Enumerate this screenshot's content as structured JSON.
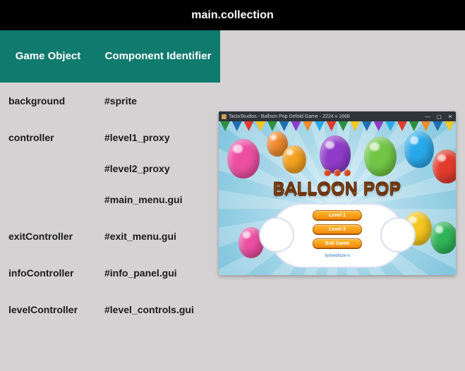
{
  "title": "main.collection",
  "table": {
    "headers": {
      "game_object": "Game Object",
      "component_identifier": "Component Identifier"
    },
    "rows": [
      {
        "go": "background",
        "ci": [
          "#sprite"
        ]
      },
      {
        "go": "controller",
        "ci": [
          "#level1_proxy",
          "#level2_proxy",
          "#main_menu.gui"
        ]
      },
      {
        "go": "exitController",
        "ci": [
          "#exit_menu.gui"
        ]
      },
      {
        "go": "infoController",
        "ci": [
          "#info_panel.gui"
        ]
      },
      {
        "go": "levelController",
        "ci": [
          "#level_controls.gui"
        ]
      }
    ]
  },
  "game_window": {
    "title": "TactxStudios - Balloon Pop Defold Game - 2224 x 1668",
    "controls": {
      "min": "—",
      "max": "▢",
      "close": "✕"
    },
    "logo_text": "BALLOON POP",
    "buttons": [
      "Level 1",
      "Level 2",
      "Exit Game"
    ],
    "credit": "tortoet/faze-n"
  },
  "bunting_colors": [
    "#2f8f3f",
    "#1f6fb0",
    "#e03b2c",
    "#f4c61f",
    "#2f8f3f",
    "#1f6fb0",
    "#903cc9",
    "#f08a2d",
    "#29a8ea",
    "#e03b2c",
    "#2f8f3f",
    "#f4c61f",
    "#1f6fb0",
    "#903cc9",
    "#29a8ea",
    "#e03b2c",
    "#2f8f3f",
    "#f08a2d",
    "#1f6fb0",
    "#f4c61f"
  ]
}
